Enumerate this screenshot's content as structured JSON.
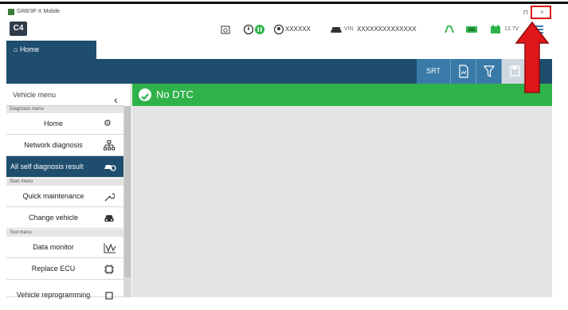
{
  "window": {
    "title": "GR8/3F-X Mobile",
    "minimize_glyph": "⊓",
    "close_glyph": "×"
  },
  "toolbar": {
    "app_badge": "C4",
    "user_mask": "XXXXXX",
    "vin_label": "VIN",
    "vin_value": "XXXXXXXXXXXXXX",
    "voltage": "12.7V"
  },
  "nav": {
    "home_tab": "Home"
  },
  "actionbar": {
    "srt_label": "SRT"
  },
  "sidebar": {
    "header": "Vehicle menu",
    "sections": {
      "diagnosis": "Diagnosis menu",
      "start": "Start menu",
      "tool": "Tool menu"
    },
    "items": [
      {
        "label": "Home",
        "icon": "gear-icon"
      },
      {
        "label": "Network diagnosis",
        "icon": "network-icon"
      },
      {
        "label": "All self diagnosis result",
        "icon": "car-search-icon"
      },
      {
        "label": "Quick maintenance",
        "icon": "wrench-icon"
      },
      {
        "label": "Change vehicle",
        "icon": "car-icon"
      },
      {
        "label": "Data monitor",
        "icon": "waveform-icon"
      },
      {
        "label": "Replace ECU",
        "icon": "chip-icon"
      },
      {
        "label": "Vehicle reprogramming",
        "icon": "chip-icon"
      }
    ]
  },
  "main": {
    "status_text": "No DTC"
  },
  "colors": {
    "navy": "#1e4d6e",
    "blue_button": "#3a7aa8",
    "status_green": "#2fb24a",
    "highlight_red": "#e0161b"
  }
}
